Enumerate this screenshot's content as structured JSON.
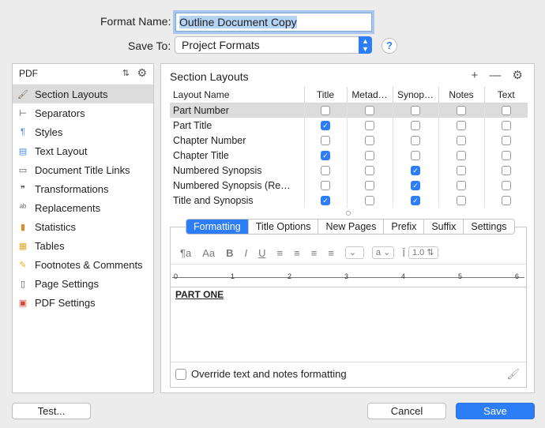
{
  "header": {
    "format_name_label": "Format Name:",
    "format_name_value": "Outline Document Copy",
    "save_to_label": "Save To:",
    "save_to_value": "Project Formats",
    "help_label": "?"
  },
  "sidebar": {
    "format": "PDF",
    "items": [
      {
        "label": "Section Layouts",
        "icon": "paintbrush-icon"
      },
      {
        "label": "Separators",
        "icon": "separator-icon"
      },
      {
        "label": "Styles",
        "icon": "styles-icon"
      },
      {
        "label": "Text Layout",
        "icon": "text-layout-icon"
      },
      {
        "label": "Document Title Links",
        "icon": "document-icon"
      },
      {
        "label": "Transformations",
        "icon": "quotes-icon"
      },
      {
        "label": "Replacements",
        "icon": "replace-icon"
      },
      {
        "label": "Statistics",
        "icon": "bar-chart-icon"
      },
      {
        "label": "Tables",
        "icon": "table-icon"
      },
      {
        "label": "Footnotes & Comments",
        "icon": "note-icon"
      },
      {
        "label": "Page Settings",
        "icon": "page-icon"
      },
      {
        "label": "PDF Settings",
        "icon": "pdf-icon"
      }
    ]
  },
  "section_layouts": {
    "title": "Section Layouts",
    "columns": [
      "Layout Name",
      "Title",
      "Metad…",
      "Synop…",
      "Notes",
      "Text"
    ],
    "rows": [
      {
        "name": "Part Number",
        "checks": [
          false,
          false,
          false,
          false,
          false
        ]
      },
      {
        "name": "Part Title",
        "checks": [
          true,
          false,
          false,
          false,
          false
        ]
      },
      {
        "name": "Chapter Number",
        "checks": [
          false,
          false,
          false,
          false,
          false
        ]
      },
      {
        "name": "Chapter Title",
        "checks": [
          true,
          false,
          false,
          false,
          false
        ]
      },
      {
        "name": "Numbered Synopsis",
        "checks": [
          false,
          false,
          true,
          false,
          false
        ]
      },
      {
        "name": "Numbered Synopsis (Re…",
        "checks": [
          false,
          false,
          true,
          false,
          false
        ]
      },
      {
        "name": "Title and Synopsis",
        "checks": [
          true,
          false,
          true,
          false,
          false
        ]
      }
    ]
  },
  "tabs": [
    "Formatting",
    "Title Options",
    "New Pages",
    "Prefix",
    "Suffix",
    "Settings"
  ],
  "editor": {
    "format_toolbar": {
      "para": "¶a",
      "font": "Aa",
      "bold": "B",
      "italic": "I",
      "underline": "U",
      "color_letter": "a",
      "line_spacing": "1.0"
    },
    "ruler_ticks": [
      "0",
      "1",
      "2",
      "3",
      "4",
      "5",
      "6"
    ],
    "sample_text": "PART ONE",
    "override_label": "Override text and notes formatting"
  },
  "buttons": {
    "test": "Test...",
    "cancel": "Cancel",
    "save": "Save"
  }
}
